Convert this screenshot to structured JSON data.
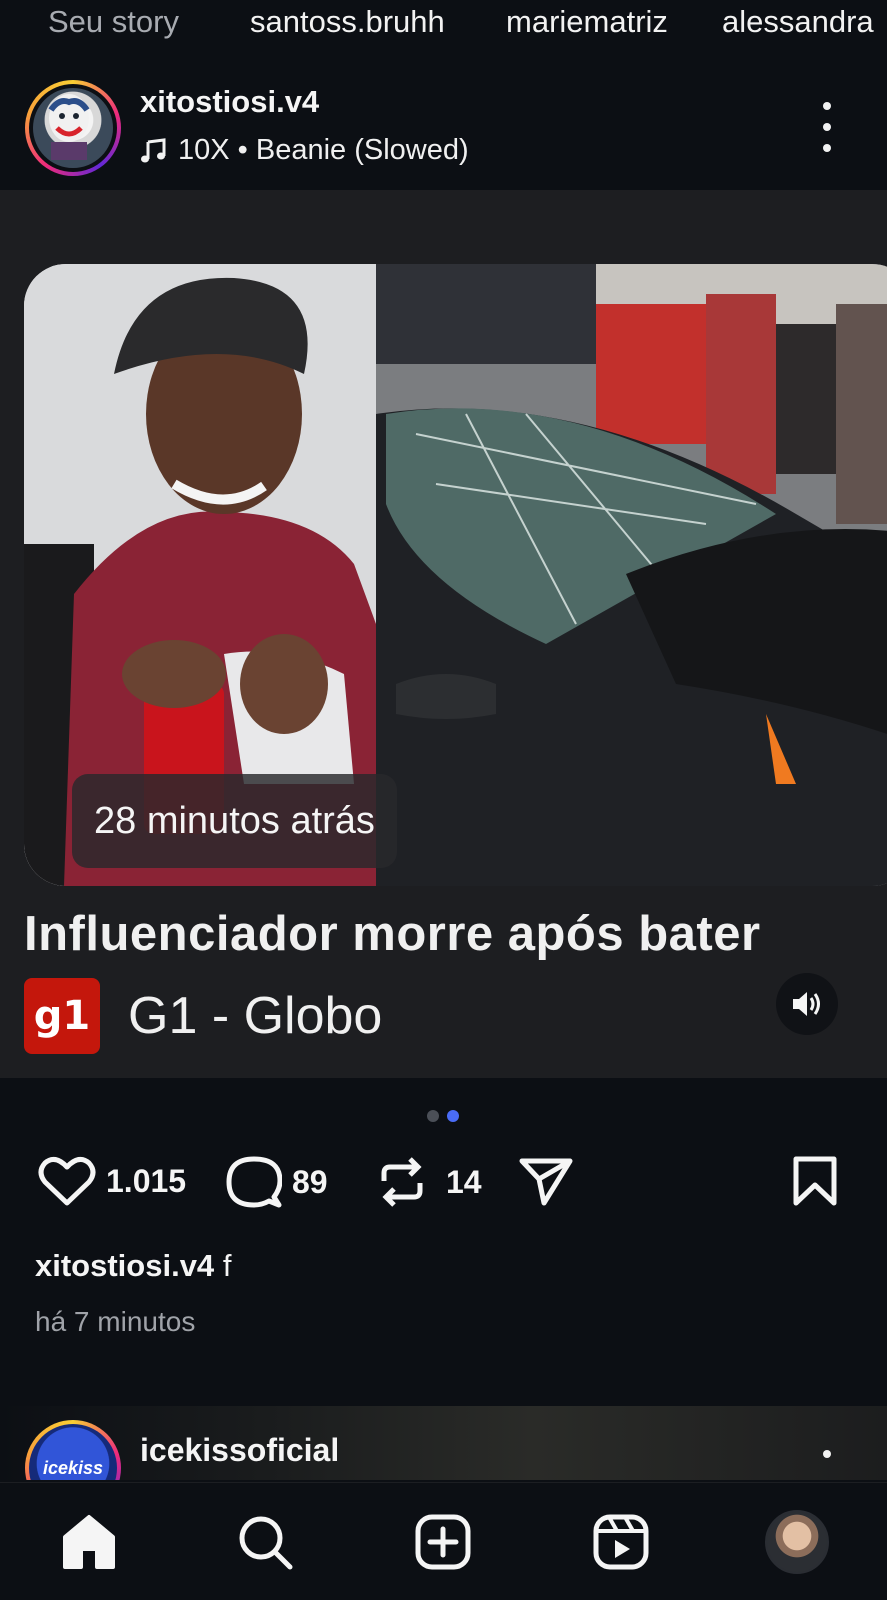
{
  "stories": {
    "items": [
      {
        "label": "Seu story",
        "self": true
      },
      {
        "label": "santoss.bruhh"
      },
      {
        "label": "mariematriz"
      },
      {
        "label": "alessandra"
      }
    ]
  },
  "post": {
    "username": "xitostiosi.v4",
    "music": "10X • Beanie (Slowed)",
    "time_badge": "28 minutos atrás",
    "headline": "Influenciador morre após bater",
    "source_logo": "g1",
    "source_name": "G1 - Globo",
    "carousel": {
      "total": 2,
      "active": 2
    },
    "likes": "1.015",
    "comments": "89",
    "reposts": "14",
    "caption_user": "xitostiosi.v4",
    "caption_text": "f",
    "posted": "há 7 minutos"
  },
  "next_post": {
    "username": "icekissoficial",
    "avatar_text": "icekiss"
  },
  "nav": {
    "items": [
      "home-icon",
      "search-icon",
      "create-icon",
      "reels-icon",
      "profile-avatar"
    ]
  },
  "colors": {
    "background": "#0c0f14",
    "media_bg": "#1d1e21",
    "g1_red": "#c4170c",
    "dot_active": "#4a6cf7",
    "dot_inactive": "#4b4f57"
  }
}
